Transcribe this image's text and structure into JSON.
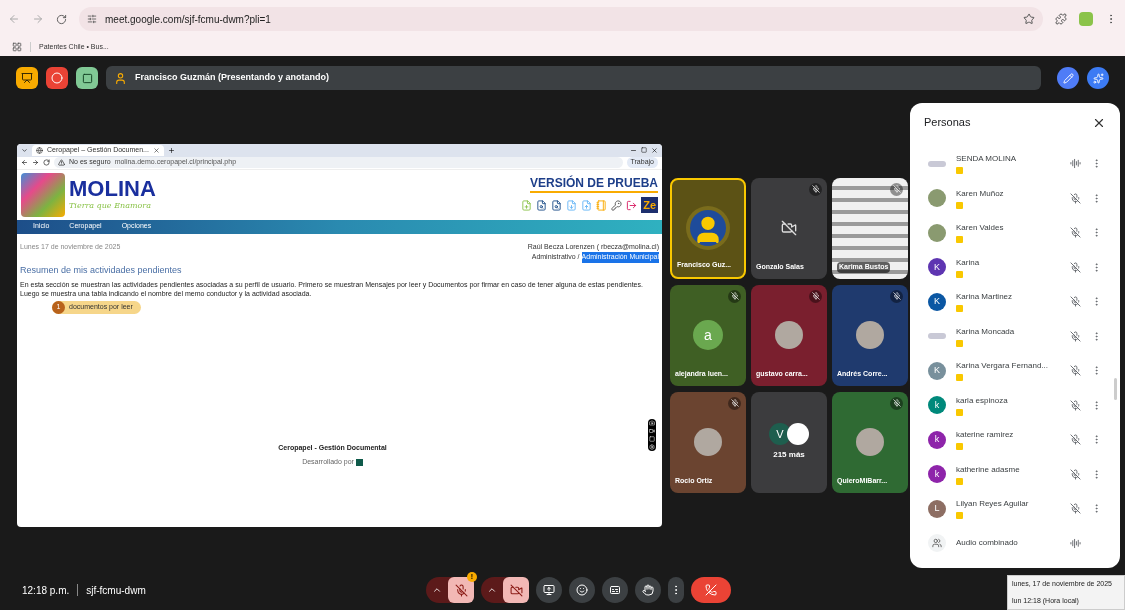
{
  "browser": {
    "url": "meet.google.com/sjf-fcmu-dwm?pli=1",
    "bookmarks": [
      {
        "label": "Patentes Chile • Bus..."
      }
    ]
  },
  "meeting_bar": {
    "presenter": "Francisco Guzmán (Presentando y anotando)"
  },
  "shared_screen": {
    "tab_title": "Ceropapel – Gestión Documen...",
    "security": "No es seguro",
    "url": "molina.demo.ceropapel.cl/principal.php",
    "profile": "Trabajo",
    "logo_title": "MOLINA",
    "logo_tagline": "Tierra que Enamora",
    "banner": "VERSIÓN DE PRUEBA",
    "user_badge": "Ze",
    "nav": [
      {
        "label": "Inicio"
      },
      {
        "label": "Ceropapel"
      },
      {
        "label": "Opciones"
      }
    ],
    "date": "Lunes 17 de noviembre de 2025",
    "user_line": "Raúl Becza Lorenzen ( rbecza@molina.cl)",
    "role": "Administrativo /",
    "department": "Administración Municipal",
    "heading": "Resumen de mis actividades pendientes",
    "description": "En esta sección se muestran las actividades pendientes asociadas a su perfil de usuario. Primero se muestran Mensajes por leer y Documentos por firmar en caso de tener alguna de estas pendientes. Luego se muestra una tabla indicando el nombre del memo conductor y la actividad asociada.",
    "pending": {
      "count": "1",
      "label": "documentos por leer"
    },
    "footer_title": "Ceropapel - Gestión Documental",
    "footer_credit": "Desarrollado por"
  },
  "tiles": [
    {
      "name": "Francisco Guz...",
      "kind": "avatar",
      "avatar": {
        "kind": "silhouette"
      },
      "color": "#5c5215",
      "muted": false,
      "speaking": true
    },
    {
      "name": "Gonzalo Salas",
      "kind": "camera_off",
      "color": "#3c3c3e",
      "muted": true,
      "speaking": false
    },
    {
      "name": "Karima Bustos",
      "kind": "video",
      "muted": true,
      "speaking": false
    },
    {
      "name": "alejandra luen...",
      "kind": "avatar",
      "avatar": {
        "kind": "letter",
        "letter": "a",
        "color": "#6aa84f"
      },
      "color": "#3f5f24",
      "muted": true,
      "speaking": false
    },
    {
      "name": "gustavo carra...",
      "kind": "avatar",
      "avatar": {
        "kind": "photo"
      },
      "color": "#7a1f2e",
      "muted": true,
      "speaking": false
    },
    {
      "name": "Andrés Corre...",
      "kind": "avatar",
      "avatar": {
        "kind": "photo"
      },
      "color": "#1f3a6e",
      "muted": true,
      "speaking": false
    },
    {
      "name": "Rocio Ortiz",
      "kind": "avatar",
      "avatar": {
        "kind": "photo"
      },
      "color": "#6b4430",
      "muted": true,
      "speaking": false
    },
    {
      "name": "215 más",
      "kind": "more",
      "avatar": {
        "kind": "letter",
        "letter": "V",
        "color": "#1e5e4e"
      },
      "color": "#3c3c3e",
      "muted": false,
      "speaking": false
    },
    {
      "name": "QuieroMiBarr...",
      "kind": "avatar",
      "avatar": {
        "kind": "photo"
      },
      "color": "#2f6a33",
      "muted": true,
      "speaking": false
    }
  ],
  "people_panel": {
    "title": "Personas",
    "people": [
      {
        "name": "SENDA MOLINA",
        "avatar": {
          "kind": "logo"
        },
        "kind": "group",
        "presenting": true
      },
      {
        "name": "Karen Muñoz",
        "avatar": {
          "kind": "photo"
        },
        "kind": "person",
        "presenting": true
      },
      {
        "name": "Karen Valdes",
        "avatar": {
          "kind": "photo"
        },
        "kind": "person",
        "presenting": true
      },
      {
        "name": "Karina",
        "avatar": {
          "kind": "letter",
          "letter": "K",
          "color": "#5e35b1"
        },
        "kind": "person",
        "presenting": true
      },
      {
        "name": "Karina Martinez",
        "avatar": {
          "kind": "letter",
          "letter": "K",
          "color": "#0b57a3"
        },
        "kind": "person",
        "presenting": true
      },
      {
        "name": "Karina Moncada",
        "avatar": {
          "kind": "logo"
        },
        "kind": "person",
        "presenting": true
      },
      {
        "name": "Karina Vergara Fernand...",
        "avatar": {
          "kind": "letter",
          "letter": "K",
          "color": "#78909c"
        },
        "kind": "person",
        "presenting": true
      },
      {
        "name": "karla espinoza",
        "avatar": {
          "kind": "letter",
          "letter": "k",
          "color": "#00897b"
        },
        "kind": "person",
        "presenting": true
      },
      {
        "name": "katerine ramirez",
        "avatar": {
          "kind": "letter",
          "letter": "k",
          "color": "#8e24aa"
        },
        "kind": "person",
        "presenting": true
      },
      {
        "name": "katherine adasme",
        "avatar": {
          "kind": "letter",
          "letter": "k",
          "color": "#8e24aa"
        },
        "kind": "person",
        "presenting": true
      },
      {
        "name": "Lilyan Reyes Aguilar",
        "avatar": {
          "kind": "letter",
          "letter": "L",
          "color": "#8d6e63"
        },
        "kind": "person",
        "presenting": true
      },
      {
        "name": "Audio combinado",
        "avatar": {
          "kind": "combined"
        },
        "kind": "combined",
        "presenting": false
      }
    ]
  },
  "bottom_bar": {
    "time": "12:18 p.m.",
    "meeting_code": "sjf-fcmu-dwm",
    "controls": [
      {
        "kind": "mic",
        "on": false,
        "alert": "!"
      },
      {
        "kind": "camera",
        "on": false
      },
      {
        "kind": "present"
      },
      {
        "kind": "emoji"
      },
      {
        "kind": "captions"
      },
      {
        "kind": "hand"
      },
      {
        "kind": "more"
      },
      {
        "kind": "leave"
      }
    ]
  },
  "tooltip": {
    "lines": [
      "lunes, 17 de noviembre de 2025",
      "lun 12:18 (Hora local)"
    ]
  }
}
